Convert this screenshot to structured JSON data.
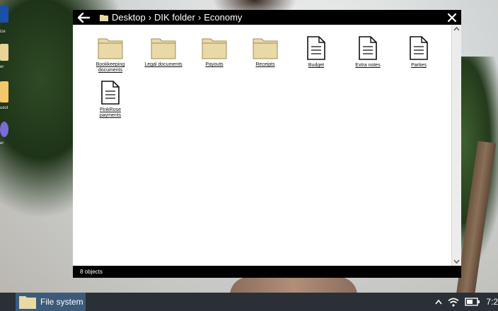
{
  "window": {
    "breadcrumb": [
      "Desktop",
      "DIK folder",
      "Economy"
    ],
    "separator": "›",
    "status_text": "8 objects"
  },
  "items": [
    {
      "label": "Bookkeeping documents",
      "kind": "folder"
    },
    {
      "label": "Legal documents",
      "kind": "folder"
    },
    {
      "label": "Payouts",
      "kind": "folder"
    },
    {
      "label": "Receipts",
      "kind": "folder"
    },
    {
      "label": "Budget",
      "kind": "file"
    },
    {
      "label": "Extra notes",
      "kind": "file"
    },
    {
      "label": "Parties",
      "kind": "file"
    },
    {
      "label": "PinkRose payments",
      "kind": "file"
    }
  ],
  "desktop_icons": [
    {
      "label": "ize"
    },
    {
      "label": "er"
    },
    {
      "label": "uest"
    },
    {
      "label": "er"
    }
  ],
  "taskbar": {
    "app_label": "File system",
    "clock": "7:2"
  },
  "colors": {
    "folder": "#e9d9a6",
    "taskbar": "#2b2f36",
    "active_task": "#3c5b7a",
    "titlebar": "#000000"
  },
  "icons": [
    "back-arrow-icon",
    "folder-icon",
    "close-icon",
    "document-icon",
    "scroll-up-icon",
    "scroll-down-icon",
    "wifi-icon",
    "battery-icon",
    "chevron-up-icon"
  ]
}
